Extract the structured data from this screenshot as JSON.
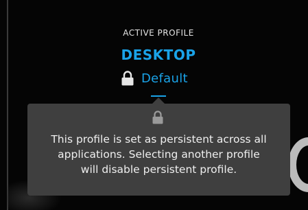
{
  "header": {
    "active_label": "ACTIVE PROFILE",
    "profile_name": "DESKTOP",
    "profile_mode": "Default"
  },
  "tooltip": {
    "message_line1": "This profile is set as persistent across all",
    "message_line2": "applications. Selecting another profile",
    "message_line3": "will disable persistent profile."
  },
  "colors": {
    "accent": "#1aa3e8",
    "background": "#050505",
    "tooltip_bg": "#3f3f3f",
    "text": "#efefef"
  },
  "icons": {
    "mode_icon": "lock-icon",
    "tooltip_icon": "lock-icon"
  }
}
